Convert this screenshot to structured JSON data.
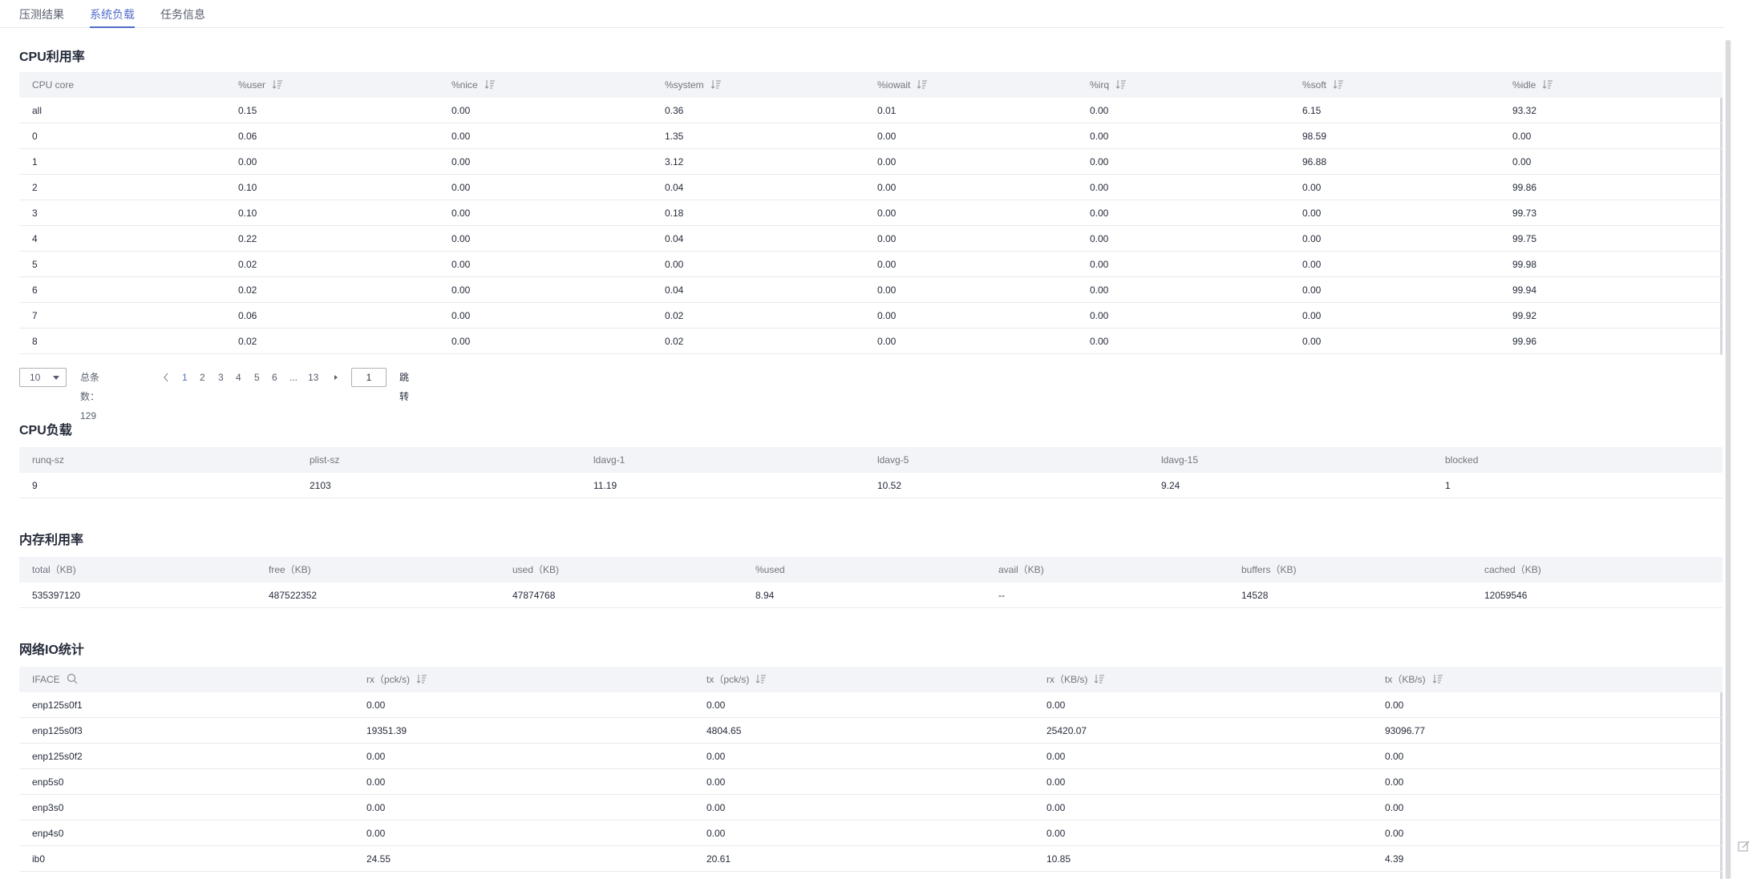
{
  "tabs": [
    "压测结果",
    "系统负载",
    "任务信息"
  ],
  "cpu_util": {
    "title": "CPU利用率",
    "headers": [
      "CPU core",
      "%user",
      "%nice",
      "%system",
      "%iowait",
      "%irq",
      "%soft",
      "%idle"
    ],
    "rows": [
      [
        "all",
        "0.15",
        "0.00",
        "0.36",
        "0.01",
        "0.00",
        "6.15",
        "93.32"
      ],
      [
        "0",
        "0.06",
        "0.00",
        "1.35",
        "0.00",
        "0.00",
        "98.59",
        "0.00"
      ],
      [
        "1",
        "0.00",
        "0.00",
        "3.12",
        "0.00",
        "0.00",
        "96.88",
        "0.00"
      ],
      [
        "2",
        "0.10",
        "0.00",
        "0.04",
        "0.00",
        "0.00",
        "0.00",
        "99.86"
      ],
      [
        "3",
        "0.10",
        "0.00",
        "0.18",
        "0.00",
        "0.00",
        "0.00",
        "99.73"
      ],
      [
        "4",
        "0.22",
        "0.00",
        "0.04",
        "0.00",
        "0.00",
        "0.00",
        "99.75"
      ],
      [
        "5",
        "0.02",
        "0.00",
        "0.00",
        "0.00",
        "0.00",
        "0.00",
        "99.98"
      ],
      [
        "6",
        "0.02",
        "0.00",
        "0.04",
        "0.00",
        "0.00",
        "0.00",
        "99.94"
      ],
      [
        "7",
        "0.06",
        "0.00",
        "0.02",
        "0.00",
        "0.00",
        "0.00",
        "99.92"
      ],
      [
        "8",
        "0.02",
        "0.00",
        "0.02",
        "0.00",
        "0.00",
        "0.00",
        "99.96"
      ]
    ]
  },
  "pager": {
    "page_size": "10",
    "total_label": "总条数：129",
    "pages": [
      "1",
      "2",
      "3",
      "4",
      "5",
      "6",
      "...",
      "13"
    ],
    "current_page": "1",
    "jump_value": "1",
    "jump_label": "跳转"
  },
  "cpu_load": {
    "title": "CPU负载",
    "headers": [
      "runq-sz",
      "plist-sz",
      "ldavg-1",
      "ldavg-5",
      "ldavg-15",
      "blocked"
    ],
    "rows": [
      [
        "9",
        "2103",
        "11.19",
        "10.52",
        "9.24",
        "1"
      ]
    ]
  },
  "mem_util": {
    "title": "内存利用率",
    "headers": [
      "total（KB)",
      "free（KB)",
      "used（KB)",
      "%used",
      "avail（KB)",
      "buffers（KB)",
      "cached（KB)"
    ],
    "rows": [
      [
        "535397120",
        "487522352",
        "47874768",
        "8.94",
        "--",
        "14528",
        "12059546"
      ]
    ]
  },
  "net_io": {
    "title": "网络IO统计",
    "headers": [
      "IFACE",
      "rx（pck/s)",
      "tx（pck/s)",
      "rx（KB/s)",
      "tx（KB/s)"
    ],
    "rows": [
      [
        "enp125s0f1",
        "0.00",
        "0.00",
        "0.00",
        "0.00"
      ],
      [
        "enp125s0f3",
        "19351.39",
        "4804.65",
        "25420.07",
        "93096.77"
      ],
      [
        "enp125s0f2",
        "0.00",
        "0.00",
        "0.00",
        "0.00"
      ],
      [
        "enp5s0",
        "0.00",
        "0.00",
        "0.00",
        "0.00"
      ],
      [
        "enp3s0",
        "0.00",
        "0.00",
        "0.00",
        "0.00"
      ],
      [
        "enp4s0",
        "0.00",
        "0.00",
        "0.00",
        "0.00"
      ],
      [
        "ib0",
        "24.55",
        "20.61",
        "10.85",
        "4.39"
      ]
    ]
  },
  "colors": {
    "accent": "#526ecc",
    "header_bg": "#f3f4f7",
    "border": "#e9eaee"
  },
  "icons": {
    "sort": "sort-icon",
    "search": "search-icon",
    "corner": "edit-icon"
  }
}
